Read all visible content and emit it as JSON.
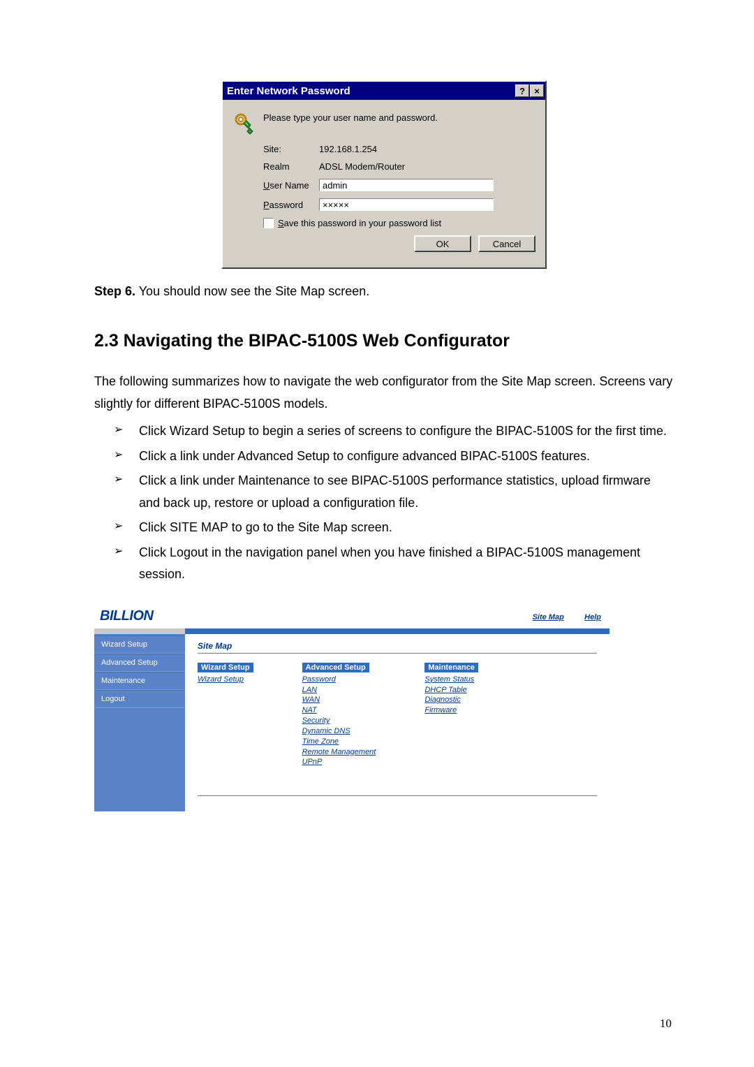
{
  "dialog": {
    "title": "Enter Network Password",
    "help_btn_glyph": "?",
    "close_btn_glyph": "×",
    "prompt": "Please type your user name and password.",
    "site_label": "Site:",
    "site_value": "192.168.1.254",
    "realm_label": "Realm",
    "realm_value": "ADSL Modem/Router",
    "user_label": "User Name",
    "user_value": "admin",
    "password_label": "Password",
    "password_value": "×××××",
    "save_checkbox": "Save this password in your password list",
    "ok_btn": "OK",
    "cancel_btn": "Cancel"
  },
  "doc": {
    "step_label": "Step 6.",
    "step_text": " You should now see the Site Map screen.",
    "section_heading": "2.3 Navigating the BIPAC-5100S Web Configurator",
    "para1": "The following summarizes how to navigate the web configurator from the Site Map screen. Screens vary slightly for different BIPAC-5100S models.",
    "bullets": [
      "Click Wizard Setup to begin a series of screens to configure the BIPAC-5100S for the first time.",
      "Click a link under Advanced Setup to configure advanced BIPAC-5100S features.",
      "Click a link under Maintenance to see BIPAC-5100S performance statistics, upload firmware and back up, restore or upload a configuration file.",
      "Click SITE MAP to go to the Site Map screen.",
      "Click Logout in the navigation panel when you have finished a BIPAC-5100S management session."
    ],
    "page_number": "10"
  },
  "sitemap": {
    "logo": "BILLION",
    "top_links": {
      "site_map": "Site Map",
      "help": "Help"
    },
    "nav": [
      "Wizard Setup",
      "Advanced Setup",
      "Maintenance",
      "Logout"
    ],
    "content_title": "Site Map",
    "columns": {
      "wizard": {
        "header": "Wizard Setup",
        "links": [
          "Wizard Setup"
        ]
      },
      "advanced": {
        "header": "Advanced Setup",
        "links": [
          "Password",
          "LAN",
          "WAN",
          "NAT",
          "Security",
          "Dynamic DNS",
          "Time Zone",
          "Remote Management",
          "UPnP"
        ]
      },
      "maintenance": {
        "header": "Maintenance",
        "links": [
          "System Status",
          "DHCP Table",
          "Diagnostic",
          "Firmware"
        ]
      }
    }
  }
}
